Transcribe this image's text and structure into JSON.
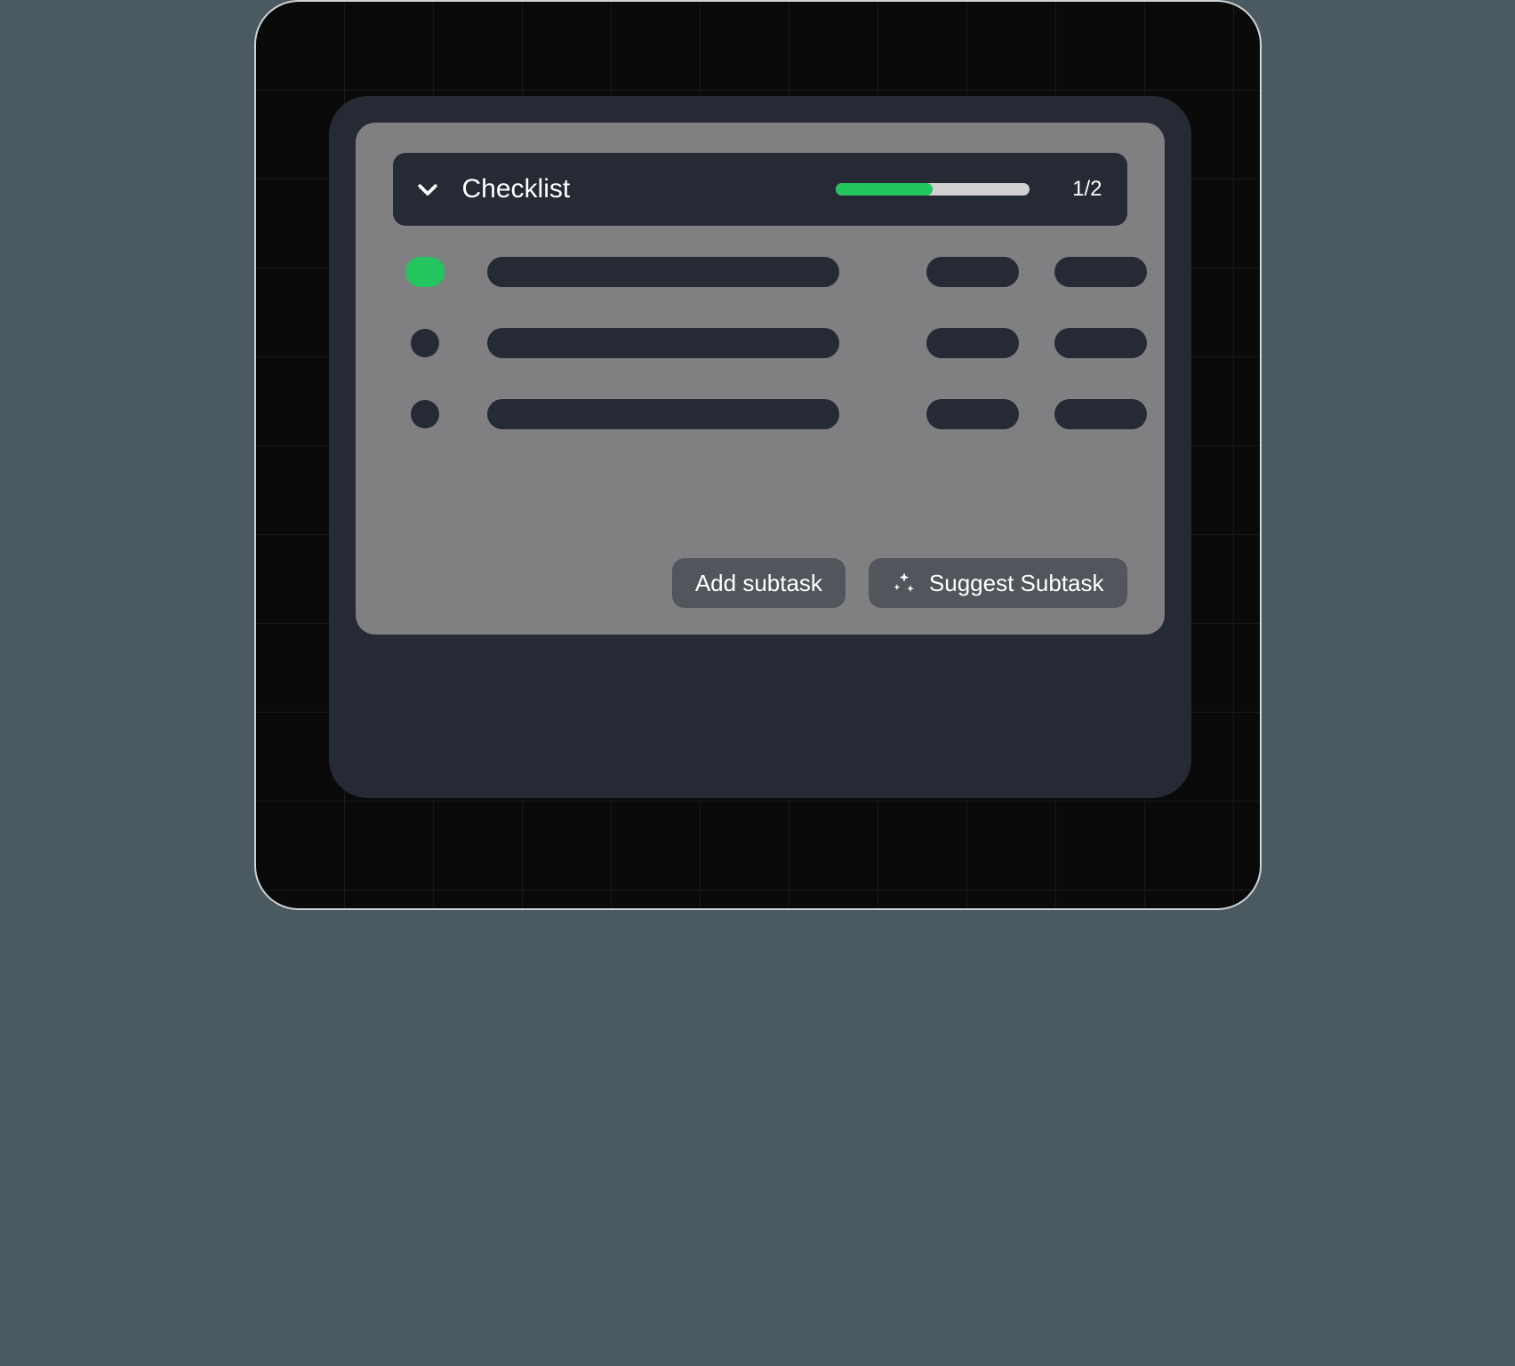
{
  "header": {
    "title": "Checklist",
    "progress_label": "1/2",
    "progress_pct": 50
  },
  "items": [
    {
      "done": true
    },
    {
      "done": false
    },
    {
      "done": false
    }
  ],
  "actions": {
    "add_label": "Add subtask",
    "suggest_label": "Suggest Subtask"
  },
  "colors": {
    "accent_green": "#22c55e",
    "panel_grey": "#808083",
    "surface_dark": "#262a34"
  }
}
